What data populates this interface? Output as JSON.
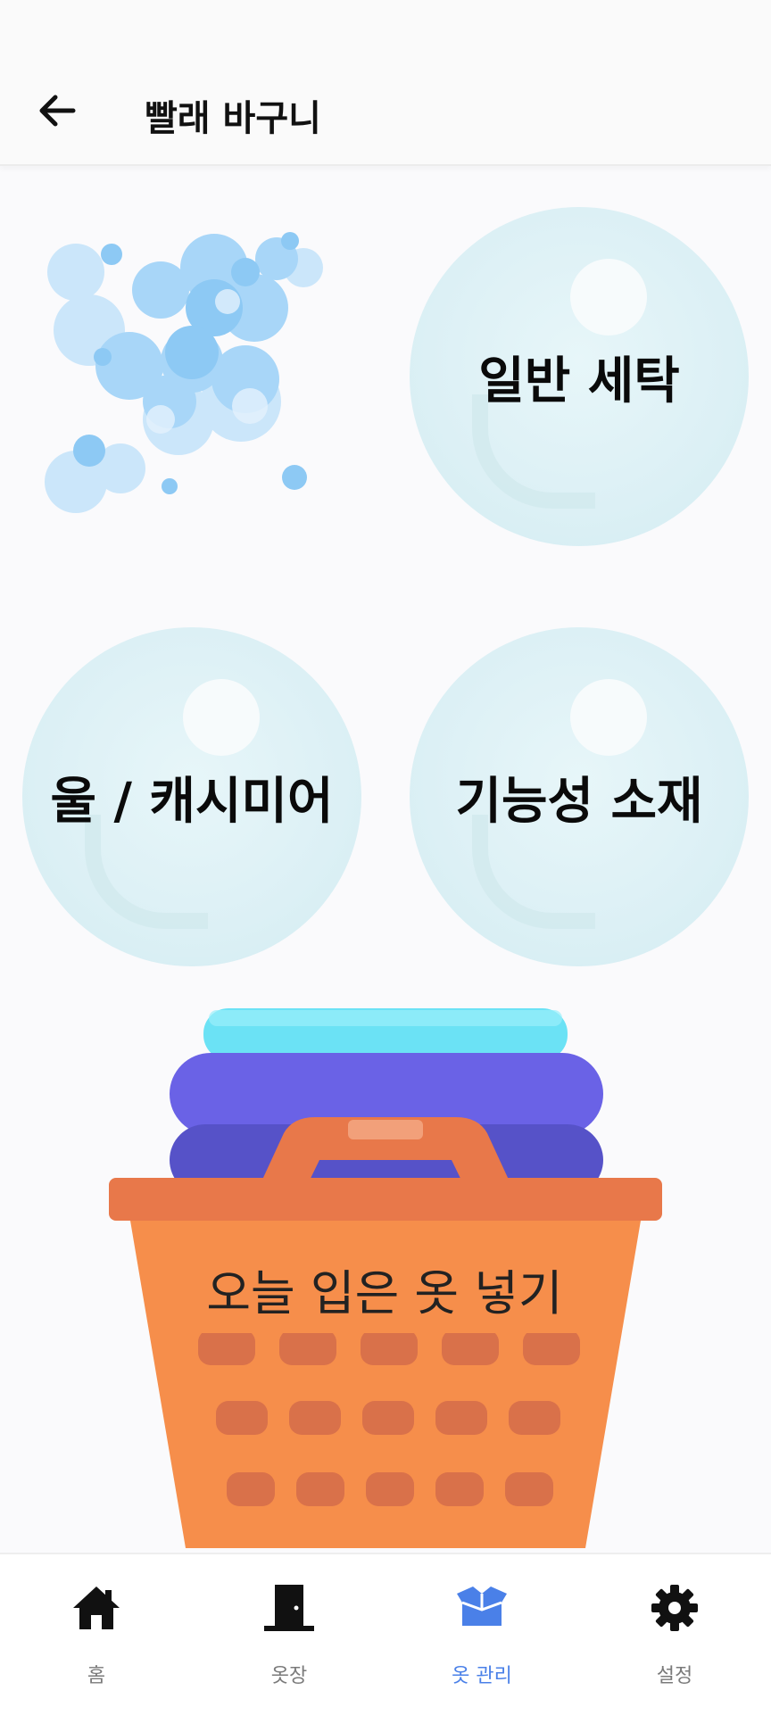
{
  "header": {
    "title": "빨래 바구니"
  },
  "wash_options": [
    {
      "label": "일반 세탁"
    },
    {
      "label": "울 / 캐시미어"
    },
    {
      "label": "기능성 소재"
    }
  ],
  "basket": {
    "label": "오늘 입은 옷 넣기"
  },
  "bottom_nav": [
    {
      "label": "홈",
      "icon": "home-icon"
    },
    {
      "label": "옷장",
      "icon": "closet-door-icon"
    },
    {
      "label": "옷 관리",
      "icon": "box-icon",
      "active": true
    },
    {
      "label": "설정",
      "icon": "gear-icon"
    }
  ],
  "colors": {
    "active_nav": "#4a80e8",
    "basket": "#f68e4b",
    "bubble": "#9fd2f6",
    "circle": "#dcf0f5"
  }
}
